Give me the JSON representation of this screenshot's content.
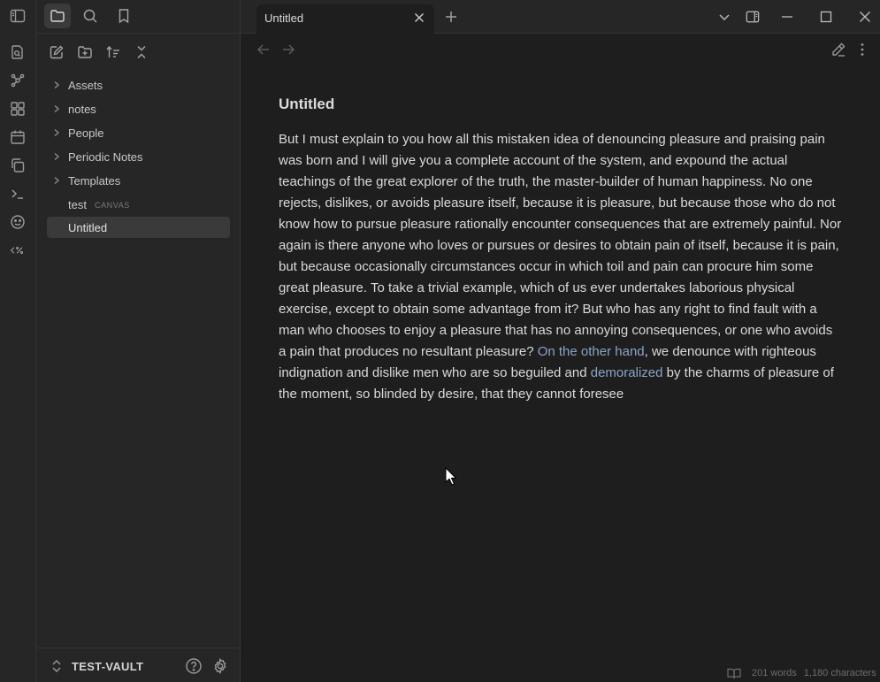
{
  "sidebar": {
    "items": [
      {
        "type": "folder",
        "label": "Assets"
      },
      {
        "type": "folder",
        "label": "notes"
      },
      {
        "type": "folder",
        "label": "People"
      },
      {
        "type": "folder",
        "label": "Periodic Notes"
      },
      {
        "type": "folder",
        "label": "Templates"
      },
      {
        "type": "file",
        "label": "test",
        "tag": "CANVAS"
      },
      {
        "type": "file",
        "label": "Untitled",
        "selected": true
      }
    ],
    "vault_name": "TEST-VAULT"
  },
  "tab": {
    "title": "Untitled"
  },
  "note": {
    "title": "Untitled",
    "body_part1": "But I must explain to you how all this mistaken idea of denouncing pleasure and praising pain was born and I will give you a complete account of the system, and expound the actual teachings of the great explorer of the truth, the master-builder of human happiness. No one rejects, dislikes, or avoids pleasure itself, because it is pleasure, but because those who do not know how to pursue pleasure rationally encounter consequences that are extremely painful. Nor again is there anyone who loves or pursues or desires to obtain pain of itself, because it is pain, but because occasionally circumstances occur in which toil and pain can procure him some great pleasure. To take a trivial example, which of us ever undertakes laborious physical exercise, except to obtain some advantage from it? But who has any right to find fault with a man who chooses to enjoy a pleasure that has no annoying consequences, or one who avoids a pain that produces no resultant pleasure? ",
    "link1": "On the other hand",
    "body_part2": ", we denounce with righteous indignation and dislike men who are so beguiled and ",
    "link2": "demoralized",
    "body_part3": " by the charms of pleasure of the moment, so blinded by desire, that they cannot foresee"
  },
  "status": {
    "words": "201 words",
    "characters": "1,180 characters"
  },
  "colors": {
    "background": "#1e1e1e",
    "sidebar": "#262626",
    "link": "#8aa4c8"
  }
}
